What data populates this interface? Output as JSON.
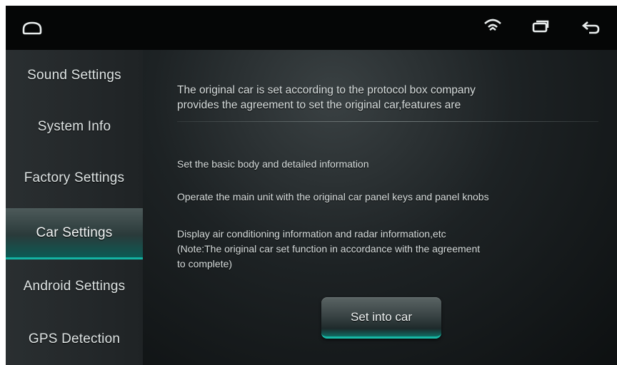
{
  "status_bar": {
    "icons": [
      "home-icon",
      "signal-icon",
      "recent-apps-icon",
      "back-icon"
    ]
  },
  "sidebar": {
    "items": [
      {
        "label": "Sound Settings",
        "active": false
      },
      {
        "label": "System Info",
        "active": false
      },
      {
        "label": "Factory Settings",
        "active": false
      },
      {
        "label": "Car Settings",
        "active": true
      },
      {
        "label": "Android Settings",
        "active": false
      },
      {
        "label": "GPS Detection",
        "active": false
      }
    ]
  },
  "main": {
    "intro_line1": "The original car is set according to the protocol box company",
    "intro_line2": "provides the agreement to set the original car,features are",
    "feature1": "Set the basic body and detailed information",
    "feature2": "Operate the main unit with the original car panel keys and panel knobs",
    "feature3_line1": "Display air conditioning information and radar information,etc",
    "feature3_line2": "(Note:The original car set function in accordance with the agreement",
    "feature3_line3": "to complete)",
    "button_label": "Set into car"
  },
  "colors": {
    "accent": "#14b3a3",
    "background": "#0b0d0e"
  }
}
